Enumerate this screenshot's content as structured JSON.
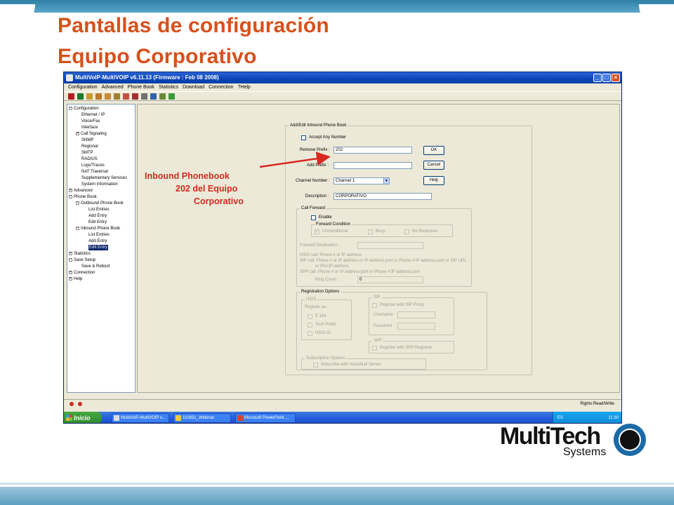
{
  "slide": {
    "title_line1": "Pantallas de configuración",
    "title_line2": "Equipo Corporativo",
    "annotation_line1": "Inbound Phonebook",
    "annotation_line2": "202 del Equipo",
    "annotation_line3": "Corporativo",
    "accent_color": "#d8501c"
  },
  "window": {
    "title": "MultiVoIP-MultiVOIP v6.11.13 (Firmware : Feb 08 2008)",
    "menu": [
      "Configuration",
      "Advanced",
      "Phone Book",
      "Statistics",
      "Download",
      "Connection",
      "?Help"
    ]
  },
  "tree": {
    "items": [
      {
        "label": "Configuration",
        "exp": "−"
      },
      {
        "label": "Ethernet / IP"
      },
      {
        "label": "Voice/Fax"
      },
      {
        "label": "Interface"
      },
      {
        "label": "Call Signaling",
        "exp": "+"
      },
      {
        "label": "SNMP"
      },
      {
        "label": "Regional"
      },
      {
        "label": "SMTP"
      },
      {
        "label": "RADIUS"
      },
      {
        "label": "Logs/Traces"
      },
      {
        "label": "NAT Traversal"
      },
      {
        "label": "Supplementary Services"
      },
      {
        "label": "System Information"
      },
      {
        "label": "Advanced",
        "exp": "+"
      },
      {
        "label": "Phone Book",
        "exp": "−"
      },
      {
        "label": "Outbound Phone Book",
        "exp": "−"
      },
      {
        "label": "List Entries"
      },
      {
        "label": "Add Entry"
      },
      {
        "label": "Edit Entry"
      },
      {
        "label": "Inbound Phone Book",
        "exp": "−"
      },
      {
        "label": "List Entries"
      },
      {
        "label": "Add Entry"
      },
      {
        "label": "Edit Entry",
        "selected": true
      },
      {
        "label": "Statistics",
        "exp": "+"
      },
      {
        "label": "Save Setup",
        "exp": "−"
      },
      {
        "label": "Save & Reboot"
      },
      {
        "label": "Connection",
        "exp": "+"
      },
      {
        "label": "Help",
        "exp": "+"
      }
    ]
  },
  "dialog": {
    "group_title": "Add/Edit Inbound Phone Book",
    "accept_any": "Accept Any Number",
    "remove_prefix_label": "Remove Prefix :",
    "remove_prefix_value": "202",
    "add_prefix_label": "Add Prefix :",
    "add_prefix_value": "",
    "channel_label": "Channel Number :",
    "channel_value": "Channel 1",
    "description_label": "Description :",
    "description_value": "CORPORATIVO",
    "ok": "OK",
    "cancel": "Cancel",
    "help": "Help",
    "call_forward": {
      "title": "Call Forward",
      "enable": "Enable",
      "condition_title": "Forward Condition",
      "unconditional": "Unconditional",
      "busy": "Busy",
      "no_response": "No Response",
      "destination_label": "Forward Destination :",
      "hint1": "H323 call: Phone # or IP address",
      "hint2": "SIP call: Phone # or IP address or IP address:port or Phone #:IP address:port or SIP URL",
      "hint3": "or Ph#:IP address",
      "hint4": "SPP call: Phone # or IP address:port or Phone #:IP address:port",
      "ring_count_label": "Ring Count :",
      "ring_count_value": "0"
    },
    "registration": {
      "title": "Registration Options",
      "h323_title": "H323",
      "register_as": "Register as :",
      "e164": "E.164",
      "tech_prefix": "Tech Prefix",
      "h323_id": "H323 ID",
      "sip_title": "SIP",
      "register_sip_proxy": "Register with SIP Proxy",
      "username": "Username",
      "password": "Password",
      "spp_title": "SPP",
      "register_spp": "Register with SPP Registrar",
      "subscription_title": "Subscription Options",
      "subscribe_voicemail": "Subscribe with VoiceMail Server"
    }
  },
  "status": {
    "rights": "Rights:Read/Write"
  },
  "taskbar": {
    "start": "Inicio",
    "tasks": [
      "MultiVoIP-MultiVOIP v...",
      "110831_Webinar",
      "Microsoft PowerPoint ..."
    ],
    "lang": "ES",
    "clock": "11:30"
  },
  "logo": {
    "brand": "MultiTech",
    "sub": "Systems"
  }
}
